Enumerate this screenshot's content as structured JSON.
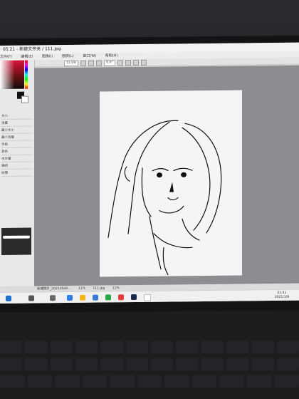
{
  "window": {
    "title": "05.21 - 新建文件夹 / 111.jpg"
  },
  "menu": {
    "items": [
      "文件(F)",
      "编辑(E)",
      "图像(I)",
      "图层(L)",
      "窗口(W)",
      "帮助(H)"
    ]
  },
  "toolbar": {
    "zoom": "11.5%",
    "angle": "0.0°"
  },
  "left_panel": {
    "props": [
      "大小",
      "浓度",
      "最小大小",
      "最小浓度",
      "手指",
      "混色",
      "水分量",
      "保持",
      "纹理"
    ]
  },
  "statusbar": {
    "file_tabs": [
      "新建图片_20210508...",
      "111.jpg"
    ],
    "zoom": "11%",
    "zoom2": "11%"
  },
  "tray": {
    "time": "21:51",
    "date": "2021/1/9"
  },
  "colors": {
    "accent": "#1f6fd1",
    "canvas_bg": "#8b8d90",
    "paper": "#f5f5f5"
  }
}
